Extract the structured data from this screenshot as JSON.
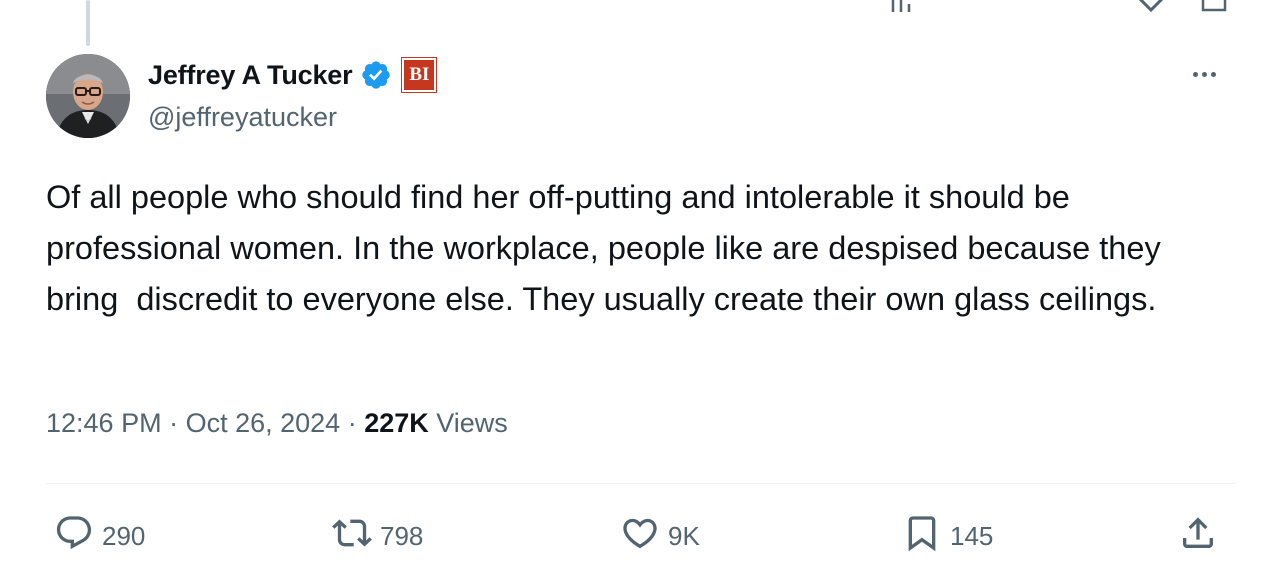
{
  "author": {
    "display_name": "Jeffrey A Tucker",
    "handle": "@jeffreyatucker",
    "verified_icon": "verified-badge-icon",
    "affiliation_badge": "BI"
  },
  "tweet": {
    "text": "Of all people who should find her off-putting and intolerable it should be professional women. In the workplace, people like are despised because they bring  discredit to everyone else. They usually create their own glass ceilings.",
    "time": "12:46 PM",
    "separator": " · ",
    "date": "Oct 26, 2024",
    "views_count": "227K",
    "views_label": " Views"
  },
  "actions": {
    "reply_count": "290",
    "retweet_count": "798",
    "like_count": "9K",
    "bookmark_count": "145"
  },
  "colors": {
    "text": "#0f1419",
    "secondary": "#536471",
    "verified": "#1d9bf0",
    "affiliation": "#c6371f",
    "divider": "#eff3f4"
  }
}
